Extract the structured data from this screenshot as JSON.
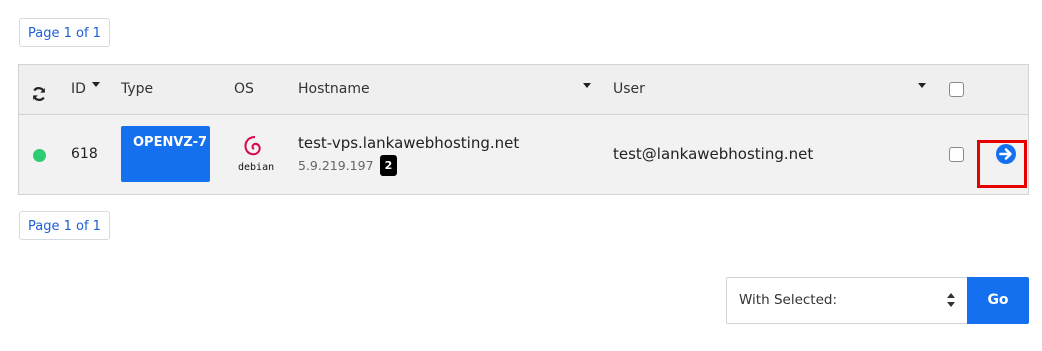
{
  "pagination": {
    "top_label": "Page 1 of 1",
    "bottom_label": "Page 1 of 1"
  },
  "table": {
    "headers": {
      "refresh_icon": "refresh-icon",
      "id": "ID",
      "type": "Type",
      "os": "OS",
      "hostname": "Hostname",
      "user": "User"
    },
    "rows": [
      {
        "status_color": "#2ecc71",
        "id": "618",
        "type": "OPENVZ-7",
        "os_label": "debian",
        "hostname": "test-vps.lankawebhosting.net",
        "ip": "5.9.219.197",
        "ip_count": "2",
        "user": "test@lankawebhosting.net"
      }
    ]
  },
  "bulk_actions": {
    "select_value": "With Selected:",
    "go_label": "Go"
  },
  "colors": {
    "primary": "#1570ef",
    "highlight_border": "#e60000",
    "debian_red": "#d70751"
  }
}
